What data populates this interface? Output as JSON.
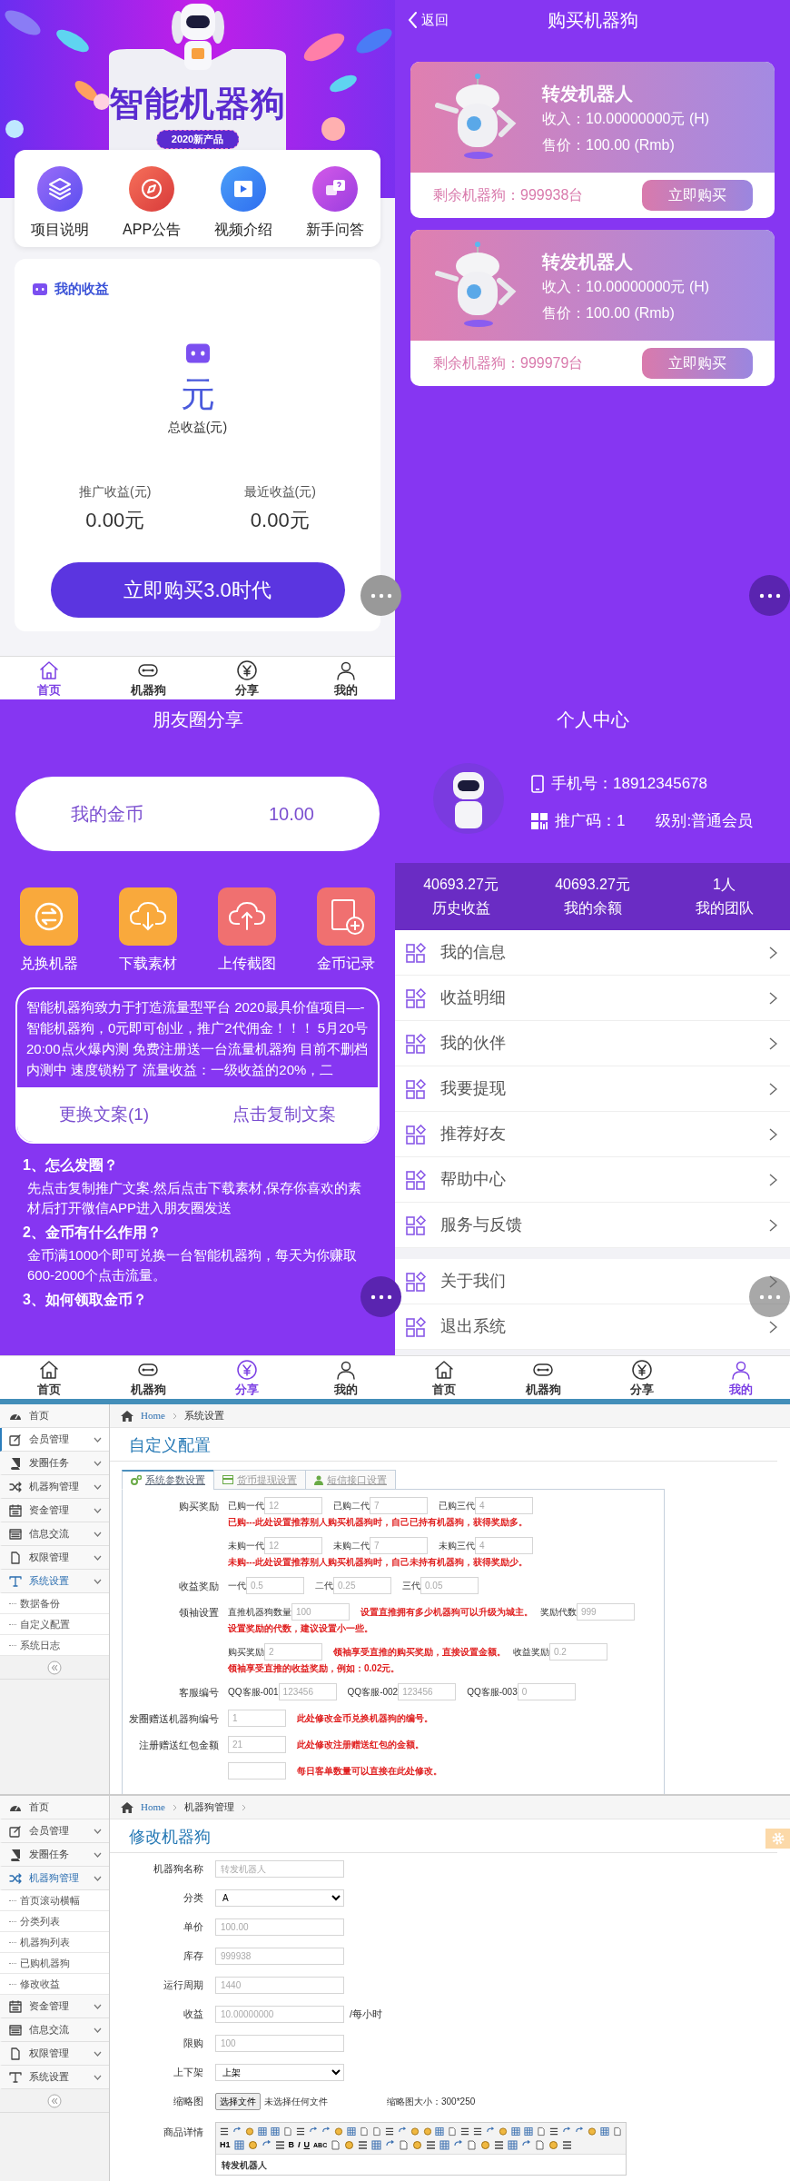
{
  "home": {
    "banner": {
      "title": "智能机器狗",
      "badge": "2020新产品"
    },
    "menu": [
      {
        "label": "项目说明"
      },
      {
        "label": "APP公告"
      },
      {
        "label": "视频介绍"
      },
      {
        "label": "新手问答"
      }
    ],
    "income": {
      "title": "我的收益",
      "total_value": "元",
      "total_label": "总收益(元)",
      "stats": [
        {
          "label": "推广收益(元)",
          "value": "0.00元"
        },
        {
          "label": "最近收益(元)",
          "value": "0.00元"
        }
      ],
      "button": "立即购买3.0时代"
    },
    "nav": [
      {
        "label": "首页",
        "selected": true
      },
      {
        "label": "机器狗",
        "selected": false
      },
      {
        "label": "分享",
        "selected": false
      },
      {
        "label": "我的",
        "selected": false
      }
    ]
  },
  "buy": {
    "back": "返回",
    "title": "购买机器狗",
    "products": [
      {
        "name": "转发机器人",
        "income": "收入：10.00000000元 (H)",
        "price": "售价：100.00 (Rmb)",
        "stock": "剩余机器狗：999938台",
        "button": "立即购买"
      },
      {
        "name": "转发机器人",
        "income": "收入：10.00000000元 (H)",
        "price": "售价：100.00 (Rmb)",
        "stock": "剩余机器狗：999979台",
        "button": "立即购买"
      }
    ]
  },
  "share": {
    "title": "朋友圈分享",
    "coins": {
      "label": "我的金币",
      "value": "10.00"
    },
    "actions": [
      {
        "label": "兑换机器"
      },
      {
        "label": "下载素材"
      },
      {
        "label": "上传截图"
      },
      {
        "label": "金币记录"
      }
    ],
    "copy_text": "智能机器狗致力于打造流量型平台 2020最具价值项目—-智能机器狗，0元即可创业，推广2代佣金！！！ 5月20号20:00点火爆内测 免费注册送一台流量机器狗 目前不删档内测中  速度锁粉了 流量收益：一级收益的20%，二",
    "buttons": [
      "更换文案(1)",
      "点击复制文案"
    ],
    "faq": [
      {
        "q": "1、怎么发圈？",
        "a": "先点击复制推广文案.然后点击下载素材,保存你喜欢的素材后打开微信APP进入朋友圈发送"
      },
      {
        "q": "2、金币有什么作用？",
        "a": "金币满1000个即可兑换一台智能机器狗，每天为你赚取600-2000个点击流量。"
      },
      {
        "q": "3、如何领取金币？"
      }
    ],
    "nav": [
      {
        "label": "首页",
        "selected": false
      },
      {
        "label": "机器狗",
        "selected": false
      },
      {
        "label": "分享",
        "selected": true
      },
      {
        "label": "我的",
        "selected": false
      }
    ]
  },
  "profile": {
    "title": "个人中心",
    "phone": "手机号：18912345678",
    "code": "推广码：1",
    "level": "级别:普通会员",
    "stats": [
      {
        "value": "40693.27元",
        "label": "历史收益"
      },
      {
        "value": "40693.27元",
        "label": "我的余额"
      },
      {
        "value": "1人",
        "label": "我的团队"
      }
    ],
    "menu_groups": [
      [
        {
          "label": "我的信息"
        },
        {
          "label": "收益明细"
        },
        {
          "label": "我的伙伴"
        },
        {
          "label": "我要提现"
        },
        {
          "label": "推荐好友"
        },
        {
          "label": "帮助中心"
        },
        {
          "label": "服务与反馈"
        }
      ],
      [
        {
          "label": "关于我们"
        },
        {
          "label": "退出系统"
        }
      ]
    ],
    "nav": [
      {
        "label": "首页",
        "selected": false
      },
      {
        "label": "机器狗",
        "selected": false
      },
      {
        "label": "分享",
        "selected": false
      },
      {
        "label": "我的",
        "selected": true
      }
    ]
  },
  "admin_config": {
    "sidebar": [
      {
        "label": "首页",
        "kind": "link",
        "selected": false
      },
      {
        "label": "会员管理",
        "kind": "group",
        "selected": true,
        "expanded": false
      },
      {
        "label": "发圈任务",
        "kind": "group",
        "selected": false,
        "expanded": false
      },
      {
        "label": "机器狗管理",
        "kind": "group",
        "selected": false,
        "expanded": false
      },
      {
        "label": "资金管理",
        "kind": "group",
        "selected": false,
        "expanded": false
      },
      {
        "label": "信息交流",
        "kind": "group",
        "selected": false,
        "expanded": false
      },
      {
        "label": "权限管理",
        "kind": "group",
        "selected": false,
        "expanded": false
      },
      {
        "label": "系统设置",
        "kind": "group",
        "selected": false,
        "expanded": true,
        "children": [
          {
            "label": "数据备份"
          },
          {
            "label": "自定义配置"
          },
          {
            "label": "系统日志"
          }
        ]
      }
    ],
    "breadcrumb": [
      "Home",
      "系统设置"
    ],
    "title": "自定义配置",
    "tabs": [
      {
        "label": "系统参数设置",
        "selected": true
      },
      {
        "label": "货币提现设置",
        "selected": false
      },
      {
        "label": "短信接口设置",
        "selected": false
      }
    ],
    "form": [
      {
        "label": "购买奖励",
        "lines": [
          [
            {
              "kind": "field",
              "prefix": "已购一代",
              "placeholder": "12"
            },
            {
              "kind": "field",
              "prefix": "已购二代",
              "placeholder": "7"
            },
            {
              "kind": "field",
              "prefix": "已购三代",
              "placeholder": "4"
            },
            {
              "kind": "note",
              "text": "已购---此处设置推荐别人购买机器狗时，自己已持有机器狗，获得奖励多。"
            }
          ],
          [
            {
              "kind": "field",
              "prefix": "未购一代",
              "placeholder": "12"
            },
            {
              "kind": "field",
              "prefix": "未购二代",
              "placeholder": "7"
            },
            {
              "kind": "field",
              "prefix": "未购三代",
              "placeholder": "4"
            },
            {
              "kind": "note",
              "text": "未购---此处设置推荐别人购买机器狗时，自己未持有机器狗，获得奖励少。"
            }
          ]
        ]
      },
      {
        "label": "收益奖励",
        "lines": [
          [
            {
              "kind": "field",
              "prefix": "一代",
              "placeholder": "0.5"
            },
            {
              "kind": "field",
              "prefix": "二代",
              "placeholder": "0.25"
            },
            {
              "kind": "field",
              "prefix": "三代",
              "placeholder": "0.05"
            }
          ]
        ]
      },
      {
        "label": "领袖设置",
        "lines": [
          [
            {
              "kind": "field",
              "prefix": "直推机器狗数量",
              "placeholder": "100"
            },
            {
              "kind": "note",
              "text": "设置直推拥有多少机器狗可以升级为城主。"
            },
            {
              "kind": "field",
              "prefix": "奖励代数",
              "placeholder": "999"
            },
            {
              "kind": "note",
              "text": "设置奖励的代数，建议设置小一些。"
            }
          ],
          [
            {
              "kind": "field",
              "prefix": "购买奖励",
              "placeholder": "2"
            },
            {
              "kind": "note",
              "text": "领袖享受直推的购买奖励，直接设置金额。"
            },
            {
              "kind": "field",
              "prefix": "收益奖励",
              "placeholder": "0.2"
            },
            {
              "kind": "note",
              "text": "领袖享受直推的收益奖励，例如：0.02元。"
            }
          ]
        ]
      },
      {
        "label": "客服编号",
        "lines": [
          [
            {
              "kind": "field",
              "prefix": "QQ客服-001",
              "placeholder": "123456"
            },
            {
              "kind": "field",
              "prefix": "QQ客服-002",
              "placeholder": "123456"
            },
            {
              "kind": "field",
              "prefix": "QQ客服-003",
              "placeholder": "0"
            }
          ]
        ]
      },
      {
        "label": "发圈赠送机器狗编号",
        "lines": [
          [
            {
              "kind": "field",
              "placeholder": "1"
            },
            {
              "kind": "note",
              "text": "此处修改金币兑换机器狗的编号。"
            }
          ]
        ]
      },
      {
        "label": "注册赠送红包金额",
        "lines": [
          [
            {
              "kind": "field",
              "placeholder": "21"
            },
            {
              "kind": "note",
              "text": "此处修改注册赠送红包的金额。"
            }
          ]
        ]
      },
      {
        "lines": [
          [
            {
              "kind": "field"
            },
            {
              "kind": "note",
              "text": "每日客单数量可以直接在此处修改。"
            }
          ]
        ]
      }
    ]
  },
  "admin_edit": {
    "sidebar": [
      {
        "label": "首页",
        "kind": "link",
        "selected": false
      },
      {
        "label": "会员管理",
        "kind": "group",
        "selected": false,
        "expanded": false
      },
      {
        "label": "发圈任务",
        "kind": "group",
        "selected": false,
        "expanded": false
      },
      {
        "label": "机器狗管理",
        "kind": "group",
        "selected": false,
        "expanded": true,
        "children": [
          {
            "label": "首页滚动横幅"
          },
          {
            "label": "分类列表"
          },
          {
            "label": "机器狗列表"
          },
          {
            "label": "已购机器狗"
          },
          {
            "label": "修改收益"
          }
        ]
      },
      {
        "label": "资金管理",
        "kind": "group",
        "selected": false,
        "expanded": false
      },
      {
        "label": "信息交流",
        "kind": "group",
        "selected": false,
        "expanded": false
      },
      {
        "label": "权限管理",
        "kind": "group",
        "selected": false,
        "expanded": false
      },
      {
        "label": "系统设置",
        "kind": "group",
        "selected": false,
        "expanded": false
      }
    ],
    "breadcrumb": [
      "Home",
      "机器狗管理"
    ],
    "title": "修改机器狗",
    "form": [
      {
        "label": "机器狗名称",
        "kind": "input",
        "placeholder": "转发机器人"
      },
      {
        "label": "分类",
        "kind": "select",
        "value": "A"
      },
      {
        "label": "单价",
        "kind": "input",
        "placeholder": "100.00"
      },
      {
        "label": "库存",
        "kind": "input",
        "placeholder": "999938"
      },
      {
        "label": "运行周期",
        "kind": "input",
        "placeholder": "1440"
      },
      {
        "label": "收益",
        "kind": "input",
        "placeholder": "10.00000000",
        "suffix": "/每小时"
      },
      {
        "label": "限购",
        "kind": "input",
        "placeholder": "100"
      },
      {
        "label": "上下架",
        "kind": "select",
        "value": "上架"
      },
      {
        "label": "缩略图",
        "kind": "file",
        "button": "选择文件",
        "status": "未选择任何文件",
        "hint": "缩略图大小：300*250"
      },
      {
        "label": "商品详情",
        "kind": "editor",
        "toolbar_text": [
          "H1",
          "B",
          "I",
          "U",
          "ABC"
        ],
        "content": "转发机器人"
      }
    ]
  }
}
